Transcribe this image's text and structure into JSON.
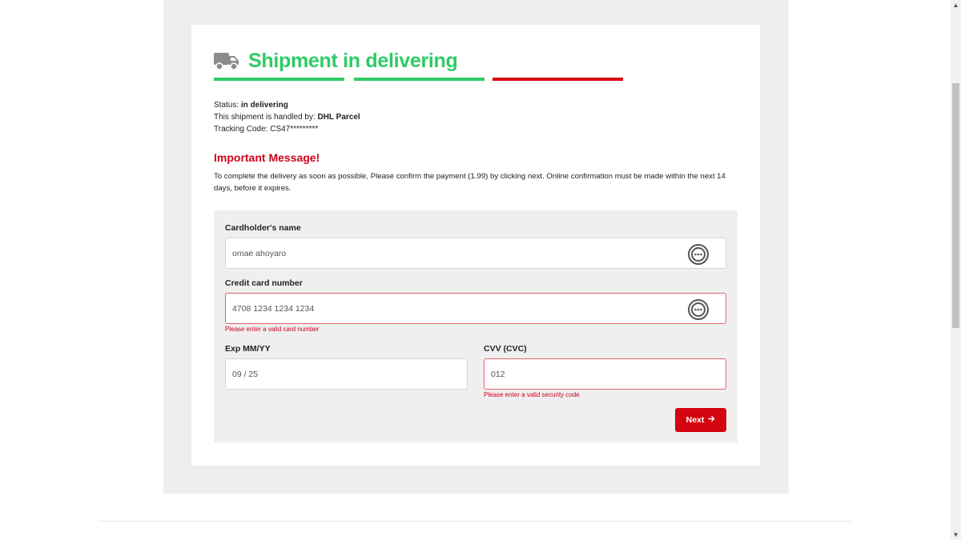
{
  "header": {
    "title": "Shipment in delivering",
    "icon": "truck-icon"
  },
  "colors": {
    "accent_green": "#2ecc65",
    "alert_red": "#d0021b",
    "button_red": "#d40511"
  },
  "progress": [
    {
      "state": "done",
      "color": "#2ecc65"
    },
    {
      "state": "done",
      "color": "#2ecc65"
    },
    {
      "state": "current",
      "color": "#d40511"
    }
  ],
  "info": {
    "status_label": "Status: ",
    "status_value": "in delivering",
    "handler_label": "This shipment is handled by: ",
    "handler_value": "DHL Parcel",
    "tracking_label": "Tracking Code: ",
    "tracking_value": "CS47*********"
  },
  "important": {
    "title": "Important Message!",
    "message": "To complete the delivery as soon as possible, Please confirm the payment (1.99) by clicking next. Online confirmation must be made within the next 14 days, before it expires."
  },
  "form": {
    "name_label": "Cardholder's name",
    "name_value": "omae ahoyaro",
    "card_label": "Credit card number",
    "card_value": "4708 1234 1234 1234",
    "card_error": "Please enter a valid card number",
    "exp_label": "Exp MM/YY",
    "exp_value": "09 / 25",
    "cvv_label": "CVV (CVC)",
    "cvv_value": "012",
    "cvv_error": "Please enter a valid security code",
    "next_label": "Next",
    "next_icon": "arrow-right-icon",
    "field_icon": "more-dots-icon"
  }
}
